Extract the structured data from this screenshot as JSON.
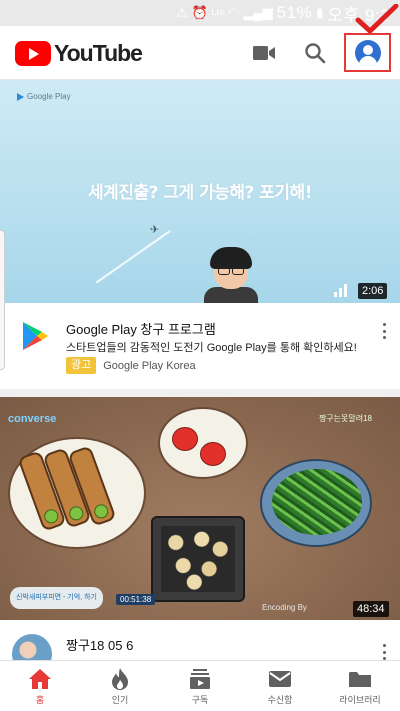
{
  "status_bar": {
    "battery": "51%",
    "time": "오후 9:2",
    "icons": [
      "alert-icon",
      "alarm-icon",
      "volte-icon",
      "wifi-icon",
      "signal-icon",
      "battery-icon"
    ]
  },
  "header": {
    "logo_text": "YouTube",
    "icons": [
      "camera-icon",
      "search-icon",
      "account-icon"
    ],
    "accent_color": "#ff0000"
  },
  "feed": {
    "ad": {
      "thumbnail_brand": "Google Play",
      "thumbnail_headline": "세계진출? 그게 가능해? 포기해!",
      "duration": "2:06",
      "title": "Google Play 창구 프로그램",
      "description": "스타트업들의 감동적인 도전기 Google Play를 통해 확인하세요!",
      "badge": "광고",
      "advertiser": "Google Play Korea"
    },
    "video": {
      "thumbnail_logo": "converse",
      "thumbnail_channel_tag": "짱구는못말려18",
      "thumbnail_caption": "신박새피부피면 - 기억, 하기",
      "thumbnail_timer": "00:51:38",
      "thumbnail_watermark": "Encoding By",
      "duration": "48:34",
      "title": "짱구18 05 6"
    }
  },
  "bottom_nav": {
    "items": [
      {
        "label": "홈",
        "icon": "home-icon",
        "active": true
      },
      {
        "label": "인기",
        "icon": "trending-icon",
        "active": false
      },
      {
        "label": "구독",
        "icon": "subscriptions-icon",
        "active": false
      },
      {
        "label": "수신함",
        "icon": "inbox-icon",
        "active": false
      },
      {
        "label": "라이브러리",
        "icon": "library-icon",
        "active": false
      }
    ]
  }
}
